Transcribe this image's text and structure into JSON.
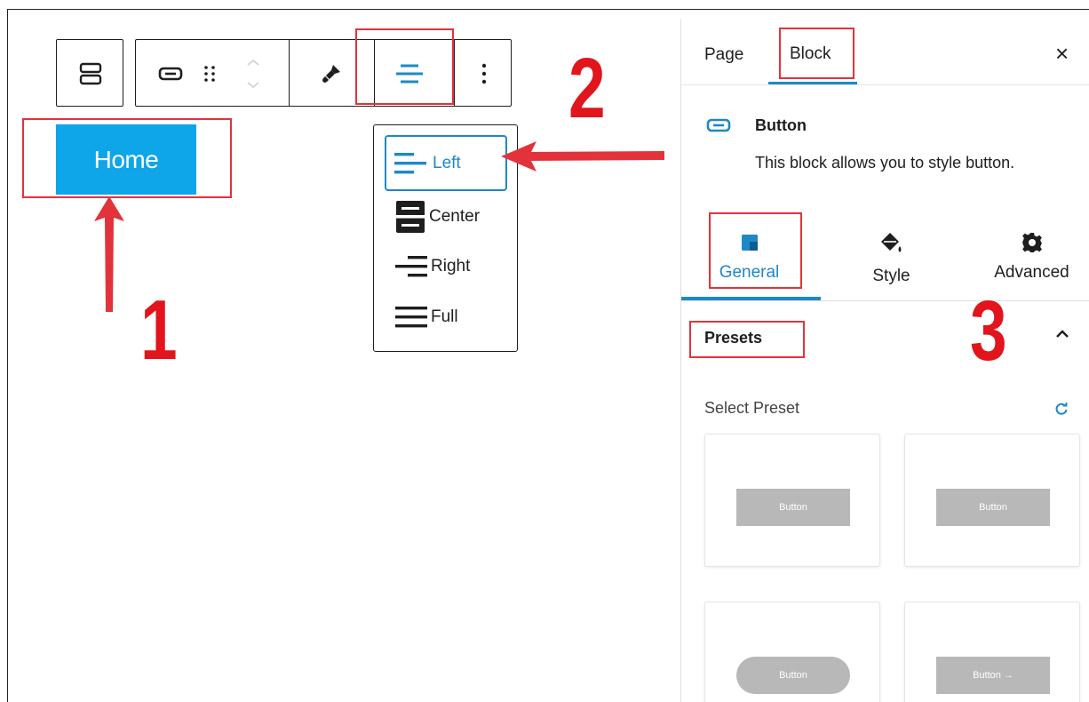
{
  "toolbar": {
    "more_icon": "vertical-ellipsis"
  },
  "canvas": {
    "home_button_label": "Home"
  },
  "align_menu": {
    "items": [
      {
        "label": "Left",
        "active": true
      },
      {
        "label": "Center",
        "active": false
      },
      {
        "label": "Right",
        "active": false
      },
      {
        "label": "Full",
        "active": false
      }
    ]
  },
  "annotations": {
    "step1": "1",
    "step2": "2",
    "step3": "3",
    "color": "#e2333b"
  },
  "sidebar": {
    "tab_page": "Page",
    "tab_block": "Block",
    "close_label": "×",
    "block_name": "Button",
    "block_description": "This block allows you to style button.",
    "sub_tabs": {
      "general": "General",
      "style": "Style",
      "advanced": "Advanced"
    },
    "presets_title": "Presets",
    "collapse_icon": "˄",
    "select_preset_label": "Select Preset",
    "reset_icon": "↻",
    "presets": [
      {
        "label": "Button"
      },
      {
        "label": "Button"
      },
      {
        "label": "Button"
      },
      {
        "label": "Button →"
      }
    ]
  },
  "colors": {
    "accent": "#1e88c7",
    "button_bg": "#0ea5e9",
    "highlight": "#e2333b",
    "preset_button": "#b8b8b8"
  }
}
